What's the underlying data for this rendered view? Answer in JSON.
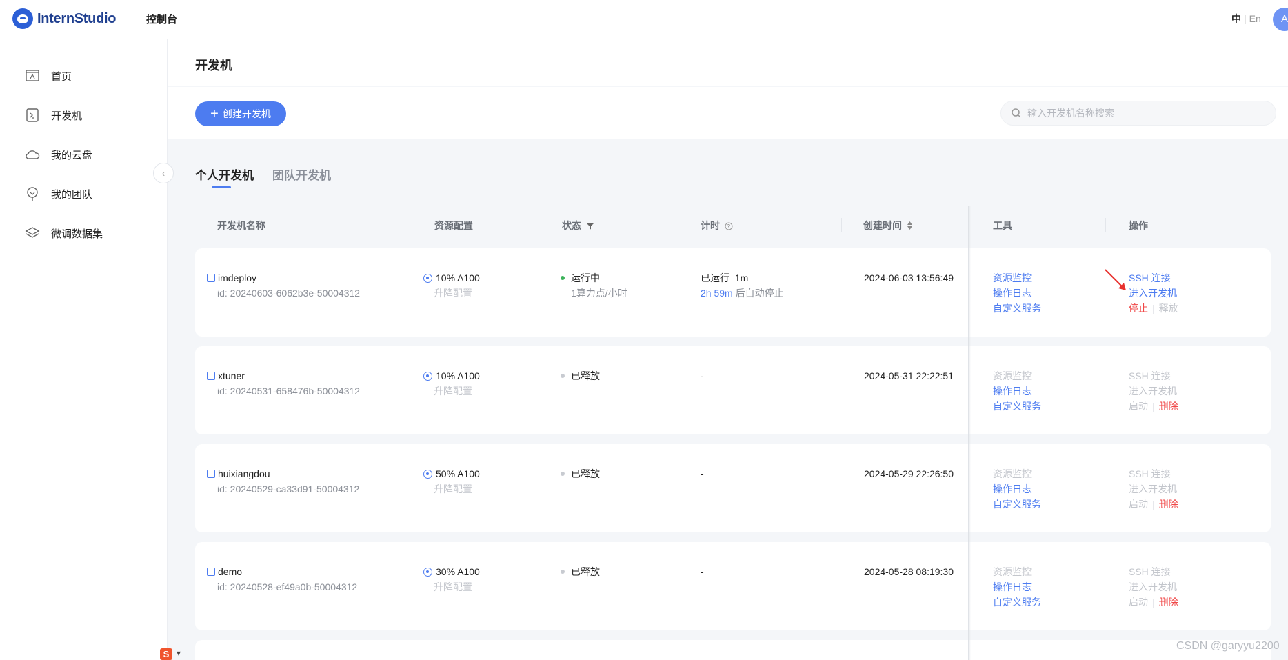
{
  "app": {
    "brand": "InternStudio",
    "console_label": "控制台",
    "avatar_letter": "A"
  },
  "lang": {
    "zh": "中",
    "sep": "|",
    "en": "En"
  },
  "sidebar": {
    "items": [
      {
        "label": "首页",
        "icon": "home-icon"
      },
      {
        "label": "开发机",
        "icon": "terminal-icon"
      },
      {
        "label": "我的云盘",
        "icon": "cloud-icon"
      },
      {
        "label": "我的团队",
        "icon": "team-icon"
      },
      {
        "label": "微调数据集",
        "icon": "layers-icon"
      }
    ],
    "collapse_glyph": "‹"
  },
  "page": {
    "title": "开发机"
  },
  "toolbar": {
    "create_label": "创建开发机",
    "search_placeholder": "输入开发机名称搜索"
  },
  "tabs": {
    "personal": "个人开发机",
    "team": "团队开发机"
  },
  "table": {
    "headers": {
      "name": "开发机名称",
      "resource": "资源配置",
      "status": "状态",
      "timer": "计时",
      "created": "创建时间",
      "tools": "工具",
      "ops": "操作"
    },
    "rows": [
      {
        "name": "imdeploy",
        "id": "id: 20240603-6062b3e-50004312",
        "resource": "10% A100",
        "resource_action": "升降配置",
        "status": "运行中",
        "status_sub": "1算力点/小时",
        "status_kind": "running",
        "timer": "已运行  1m",
        "timer_highlight": "2h 59m",
        "timer_tail": " 后自动停止",
        "created": "2024-06-03 13:56:49",
        "tools": [
          "资源监控",
          "操作日志",
          "自定义服务"
        ],
        "ops": {
          "ssh": "SSH 连接",
          "enter": "进入开发机",
          "primary": "停止",
          "secondary": "释放"
        }
      },
      {
        "name": "xtuner",
        "id": "id: 20240531-658476b-50004312",
        "resource": "10% A100",
        "resource_action": "升降配置",
        "status": "已释放",
        "status_kind": "released",
        "timer": "-",
        "created": "2024-05-31 22:22:51",
        "tools": [
          "资源监控",
          "操作日志",
          "自定义服务"
        ],
        "ops": {
          "ssh": "SSH 连接",
          "enter": "进入开发机",
          "primary": "启动",
          "secondary": "删除"
        }
      },
      {
        "name": "huixiangdou",
        "id": "id: 20240529-ca33d91-50004312",
        "resource": "50% A100",
        "resource_action": "升降配置",
        "status": "已释放",
        "status_kind": "released",
        "timer": "-",
        "created": "2024-05-29 22:26:50",
        "tools": [
          "资源监控",
          "操作日志",
          "自定义服务"
        ],
        "ops": {
          "ssh": "SSH 连接",
          "enter": "进入开发机",
          "primary": "启动",
          "secondary": "删除"
        }
      },
      {
        "name": "demo",
        "id": "id: 20240528-ef49a0b-50004312",
        "resource": "30% A100",
        "resource_action": "升降配置",
        "status": "已释放",
        "status_kind": "released",
        "timer": "-",
        "created": "2024-05-28 08:19:30",
        "tools": [
          "资源监控",
          "操作日志",
          "自定义服务"
        ],
        "ops": {
          "ssh": "SSH 连接",
          "enter": "进入开发机",
          "primary": "启动",
          "secondary": "删除"
        }
      }
    ]
  },
  "colors": {
    "accent": "#4d7cf0",
    "danger": "#f04848",
    "running": "#3cb35a",
    "annotation_arrow": "#e8322f"
  },
  "watermark": "CSDN @garyyu2200",
  "csdn_badge": "S"
}
